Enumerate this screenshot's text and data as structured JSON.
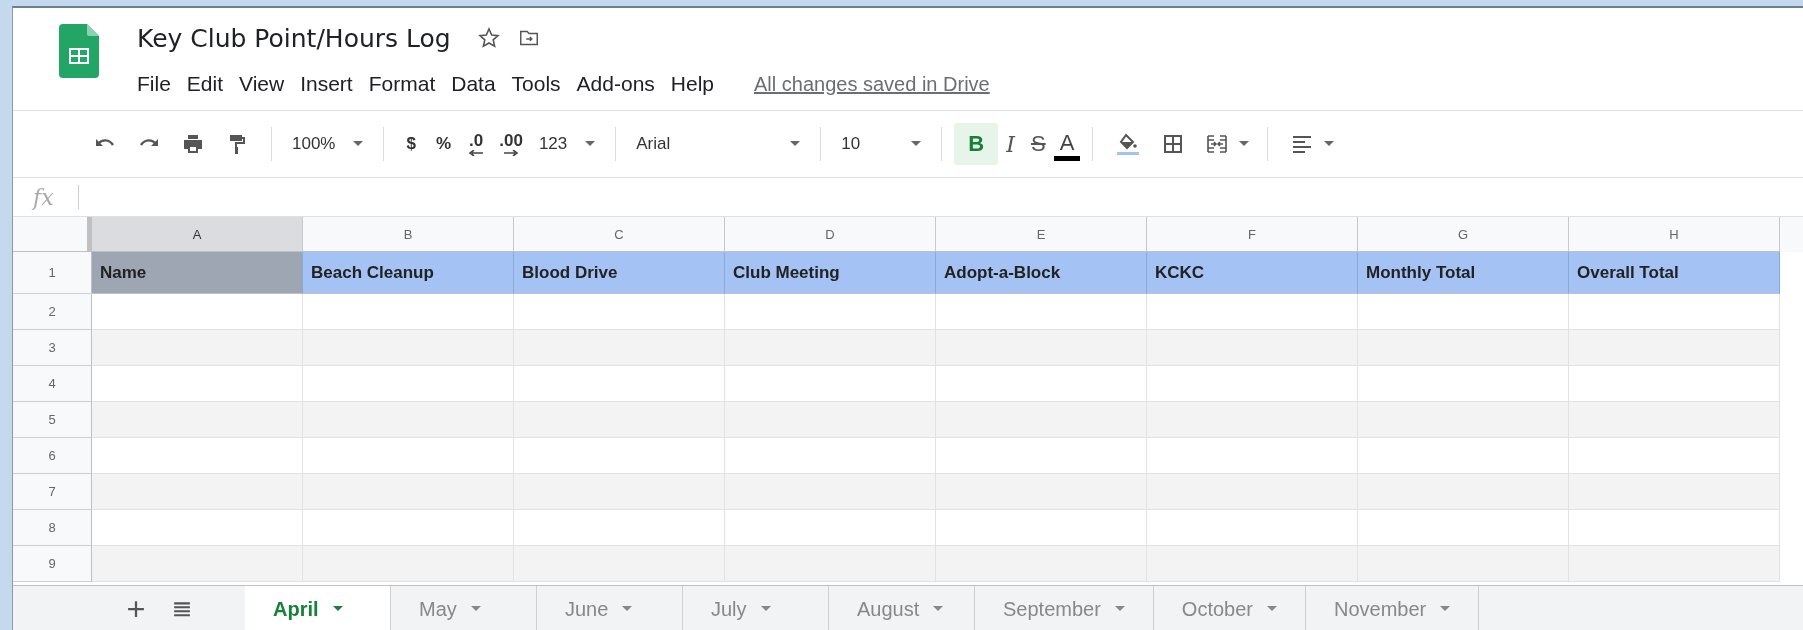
{
  "document": {
    "title": "Key Club Point/Hours Log",
    "save_status": "All changes saved in Drive"
  },
  "menu": [
    "File",
    "Edit",
    "View",
    "Insert",
    "Format",
    "Data",
    "Tools",
    "Add-ons",
    "Help"
  ],
  "toolbar": {
    "zoom": "100%",
    "currency": "$",
    "percent": "%",
    "decrease_decimals": ".0",
    "increase_decimals": ".00",
    "number_format": "123",
    "font": "Arial",
    "font_size": "10",
    "bold": {
      "label": "B",
      "active": true
    },
    "italic": "I",
    "strikethrough": "S",
    "text_color": "A"
  },
  "formula_bar": {
    "label": "fx"
  },
  "columns": [
    {
      "letter": "A",
      "selected": true
    },
    {
      "letter": "B",
      "selected": false
    },
    {
      "letter": "C",
      "selected": false
    },
    {
      "letter": "D",
      "selected": false
    },
    {
      "letter": "E",
      "selected": false
    },
    {
      "letter": "F",
      "selected": false
    },
    {
      "letter": "G",
      "selected": false
    },
    {
      "letter": "H",
      "selected": false
    }
  ],
  "header_row": {
    "number": "1",
    "cells": [
      {
        "text": "Name",
        "selected": true
      },
      {
        "text": "Beach Cleanup",
        "selected": false
      },
      {
        "text": "Blood Drive",
        "selected": false
      },
      {
        "text": "Club Meeting",
        "selected": false
      },
      {
        "text": "Adopt-a-Block",
        "selected": false
      },
      {
        "text": "KCKC",
        "selected": false
      },
      {
        "text": "Monthly Total",
        "selected": false
      },
      {
        "text": "Overall Total",
        "selected": false
      }
    ]
  },
  "rows": [
    {
      "number": "2"
    },
    {
      "number": "3"
    },
    {
      "number": "4"
    },
    {
      "number": "5"
    },
    {
      "number": "6"
    },
    {
      "number": "7"
    },
    {
      "number": "8"
    },
    {
      "number": "9"
    }
  ],
  "sheet_tabs": [
    {
      "label": "April",
      "selected": true
    },
    {
      "label": "May",
      "selected": false
    },
    {
      "label": "June",
      "selected": false
    },
    {
      "label": "July",
      "selected": false
    },
    {
      "label": "August",
      "selected": false
    },
    {
      "label": "September",
      "selected": false
    },
    {
      "label": "October",
      "selected": false
    },
    {
      "label": "November",
      "selected": false
    }
  ]
}
